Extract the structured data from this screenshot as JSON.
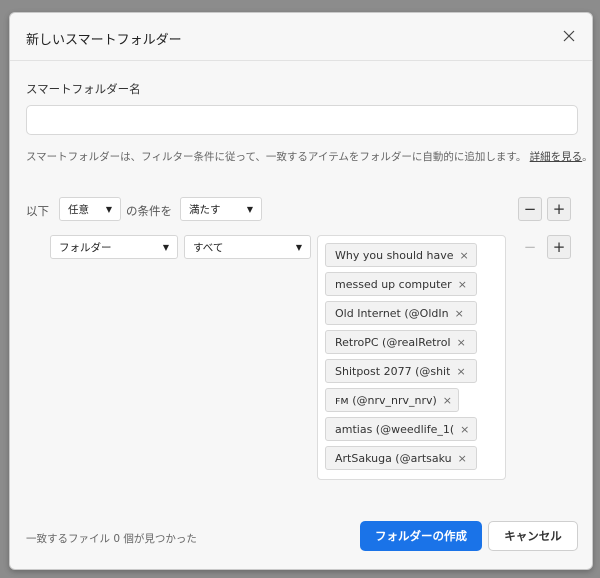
{
  "dialog": {
    "title": "新しいスマートフォルダー",
    "name_label": "スマートフォルダー名",
    "name_value": "",
    "help_text": "スマートフォルダーは、フィルター条件に従って、一致するアイテムをフォルダーに自動的に追加します。",
    "help_link": "詳細を見る",
    "help_period": "。"
  },
  "conditions": {
    "prefix": "以下",
    "match_any": "任意",
    "middle": "の条件を",
    "satisfy": "満たす",
    "minus_symbol": "−",
    "plus_symbol": "+"
  },
  "rule": {
    "field": "フォルダー",
    "operator": "すべて",
    "tags": [
      {
        "label": "Why you should have"
      },
      {
        "label": "messed up computer"
      },
      {
        "label": "Old Internet (@OldIn"
      },
      {
        "label": "RetroPC (@realRetroI"
      },
      {
        "label": "Shitpost 2077 (@shit"
      },
      {
        "label": "ꜰᴍ (@nrv_nrv_nrv)"
      },
      {
        "label": "amtias (@weedlife_1("
      },
      {
        "label": "ArtSakuga (@artsaku"
      }
    ],
    "tag_close": "×"
  },
  "footer": {
    "match_count": "一致するファイル 0 個が見つかった",
    "create_label": "フォルダーの作成",
    "cancel_label": "キャンセル"
  },
  "colors": {
    "primary": "#1a73e8",
    "dialog_bg": "#f7f7f7"
  }
}
